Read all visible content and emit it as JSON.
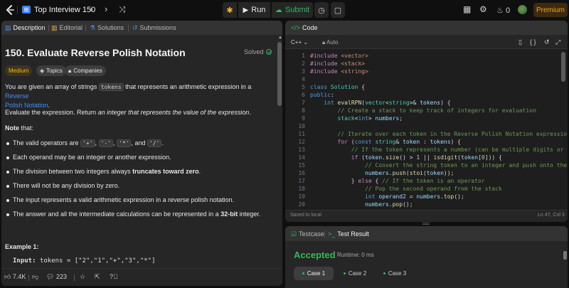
{
  "topbar": {
    "study_title": "Top Interview 150",
    "prev": "‹",
    "next": "›",
    "shuffle": "⤨",
    "run_label": "Run",
    "submit_label": "Submit",
    "streak_count": "0",
    "premium_label": "Premium"
  },
  "left_tabs": [
    "Description",
    "Editorial",
    "Solutions",
    "Submissions"
  ],
  "problem": {
    "title": "150. Evaluate Reverse Polish Notation",
    "status": "Solved",
    "difficulty": "Medium",
    "topics_label": "Topics",
    "companies_label": "Companies",
    "intro_1": "You are given an array of strings ",
    "intro_code": "tokens",
    "intro_2": " that represents an arithmetic expression in a ",
    "intro_link_a": "Reverse",
    "intro_link_b": "Polish Notation",
    "intro_end": ".",
    "eval_1": "Evaluate the expression. Return ",
    "eval_em": "an integer that represents the value of the expression",
    "eval_end": ".",
    "note_label": "Note",
    "note_suffix": " that:",
    "bullet_ops_prefix": "The valid operators are ",
    "op1": "'+'",
    "op2": "'-'",
    "op3": "'*'",
    "op_and": ", and ",
    "op4": "'/'",
    "bullet2": "Each operand may be an integer or another expression.",
    "bullet3_prefix": "The division between two integers always ",
    "bullet3_bold": "truncates toward zero",
    "bullet4": "There will not be any division by zero.",
    "bullet5": "The input represents a valid arithmetic expression in a reverse polish notation.",
    "bullet6_prefix": "The answer and all the intermediate calculations can be represented in a ",
    "bullet6_bold": "32-bit",
    "bullet6_suffix": " integer.",
    "example_title": "Example 1:",
    "example_input_label": "Input:",
    "example_input_value": "tokens = [\"2\",\"1\",\"+\",\"3\",\"*\"]"
  },
  "bottom_bar": {
    "likes": "7.4K",
    "comments": "223"
  },
  "code_panel": {
    "title": "Code",
    "language": "C++",
    "mode": "Auto",
    "saved": "Saved to local",
    "cursor": "Ln 47, Col 3"
  },
  "result_panel": {
    "tab_testcase": "Testcase",
    "tab_result": "Test Result",
    "status": "Accepted",
    "runtime": "Runtime: 0 ms",
    "cases": [
      "Case 1",
      "Case 2",
      "Case 3"
    ]
  },
  "colors": {
    "accent_green": "#2cbb5d",
    "brand_orange": "#ffa116",
    "link_blue": "#3e8ef7"
  }
}
